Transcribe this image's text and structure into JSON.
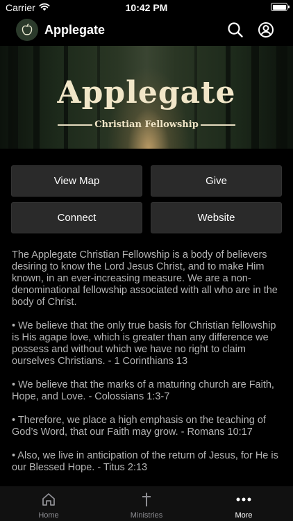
{
  "status_bar": {
    "carrier": "Carrier",
    "time": "10:42 PM"
  },
  "header": {
    "title": "Applegate"
  },
  "hero": {
    "title": "Applegate",
    "subtitle": "Christian Fellowship"
  },
  "buttons": {
    "view_map": "View Map",
    "give": "Give",
    "connect": "Connect",
    "website": "Website"
  },
  "content": {
    "paragraphs": [
      "The Applegate Christian Fellowship is a body of believers desiring to know the Lord Jesus Christ, and to make Him known, in an ever-increasing measure. We are a non-denominational fellowship associated with all who are in the body of Christ.",
      "• We believe that the only true basis for Christian fellowship is His agape love, which is greater than any difference we possess and without which we have no right to claim ourselves Christians. - 1 Corinthians 13",
      "• We believe that the marks of a maturing church are Faith, Hope, and Love. - Colossians 1:3-7",
      "• Therefore, we place a high emphasis on the teaching of God’s Word, that our Faith may grow. - Romans 10:17",
      "• Also, we live in anticipation of the return of Jesus, for He is our Blessed Hope. - Titus 2:13"
    ]
  },
  "tab_bar": {
    "tabs": [
      {
        "label": "Home",
        "icon": "home-icon"
      },
      {
        "label": "Ministries",
        "icon": "cross-icon"
      },
      {
        "label": "More",
        "icon": "more-icon"
      }
    ],
    "active": "More"
  },
  "colors": {
    "background": "#000000",
    "button": "#2a2a2a",
    "body_text": "#b5b5b5",
    "hero_text": "#f1e6c8"
  }
}
